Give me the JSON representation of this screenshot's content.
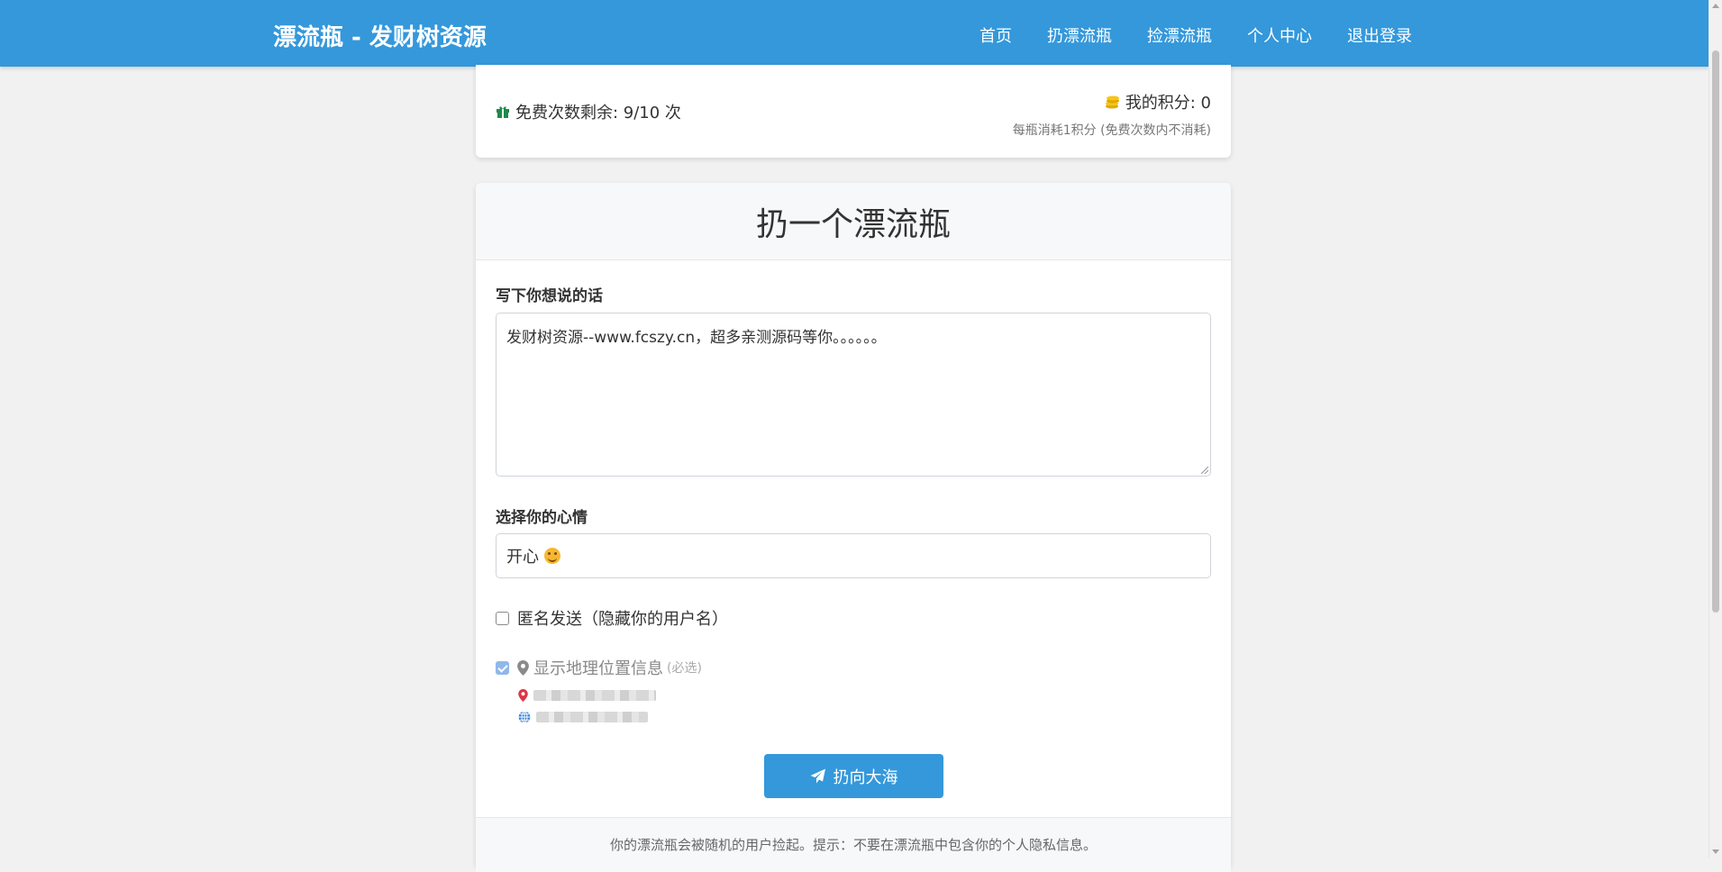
{
  "brand": "漂流瓶 - 发财树资源",
  "nav": [
    "首页",
    "扔漂流瓶",
    "捡漂流瓶",
    "个人中心",
    "退出登录"
  ],
  "stats": {
    "free_label": "免费次数剩余: 9/10 次",
    "points_label": "我的积分: 0",
    "points_note": "每瓶消耗1积分 (免费次数内不消耗)"
  },
  "form": {
    "title": "扔一个漂流瓶",
    "message_label": "写下你想说的话",
    "message_value": "发财树资源--www.fcszy.cn，超多亲测源码等你。。。。。。",
    "mood_label": "选择你的心情",
    "mood_value": "开心",
    "anonymous_label": "匿名发送（隐藏你的用户名）",
    "anonymous_checked": false,
    "location_label": "显示地理位置信息",
    "location_required": "(必选)",
    "location_checked": true,
    "submit_label": "扔向大海",
    "footer_note": "你的漂流瓶会被随机的用户捡起。提示：不要在漂流瓶中包含你的个人隐私信息。"
  },
  "colors": {
    "primary": "#3498db",
    "background": "#f1f1f1"
  },
  "icons": [
    "gift-icon",
    "coins-icon",
    "map-marker-icon",
    "globe-icon",
    "paper-plane-icon"
  ]
}
